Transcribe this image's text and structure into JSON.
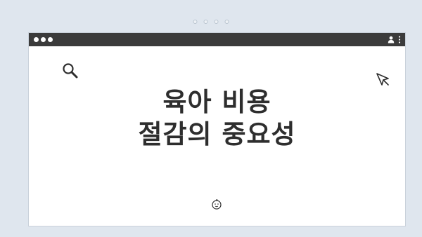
{
  "browser": {
    "title_line1": "육아 비용",
    "title_line2": "절감의 중요성"
  },
  "icons": {
    "search": "search-icon",
    "cursor": "cursor-icon",
    "baby": "baby-icon",
    "user": "user-icon",
    "menu": "menu-icon"
  },
  "colors": {
    "background": "#dfe6ee",
    "title_bar": "#3b3b3b",
    "title_text": "#2e2e2e"
  }
}
